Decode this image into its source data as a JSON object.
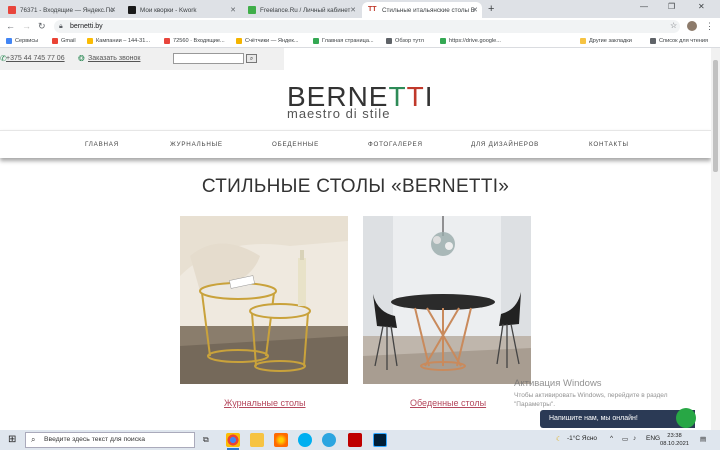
{
  "browser": {
    "tabs": [
      {
        "title": "76371 - Входящие — Яндекс.По",
        "color": "#e8453c"
      },
      {
        "title": "Мои кворки - Kwork",
        "color": "#1a1a1a"
      },
      {
        "title": "Freelance.Ru / Личный кабинет",
        "color": "#3fae49"
      },
      {
        "title": "Стильные итальянские столы В",
        "color": "#c0392b",
        "active": true
      }
    ],
    "new_tab": "+",
    "url": "bernetti.by",
    "bookmarks": [
      "Сервисы",
      "Gmail",
      "Кампании – 144-31...",
      "72560 · Входящие...",
      "Счётчики — Яндек...",
      "Главная страница...",
      "Обзор тутл",
      "https://drive.google...",
      "Другие закладки",
      "Список для чтения"
    ]
  },
  "site": {
    "phone": "+375 44 745 77 06",
    "callback": "Заказать звонок",
    "logo": {
      "part1": "BERNE",
      "t1": "T",
      "t2": "T",
      "part2": "I",
      "tagline": "maestro di stile"
    },
    "menu": [
      "ГЛАВНАЯ",
      "ЖУРНАЛЬНЫЕ",
      "ОБЕДЕННЫЕ",
      "ФОТОГАЛЕРЕЯ",
      "ДЛЯ ДИЗАЙНЕРОВ",
      "КОНТАКТЫ"
    ],
    "heading": "СТИЛЬНЫЕ СТОЛЫ «BERNETTI»",
    "products": [
      {
        "caption": "Журнальные столы"
      },
      {
        "caption": "Обеденные столы"
      }
    ],
    "chat_label": "Напишите нам, мы онлайн!"
  },
  "windows_activation": {
    "title": "Активация Windows",
    "text": "Чтобы активировать Windows, перейдите в раздел \"Параметры\"."
  },
  "taskbar": {
    "search_placeholder": "Введите здесь текст для поиска",
    "weather": "-1°C  Ясно",
    "lang": "ENG",
    "time": "23:38",
    "date": "08.10.2021"
  }
}
